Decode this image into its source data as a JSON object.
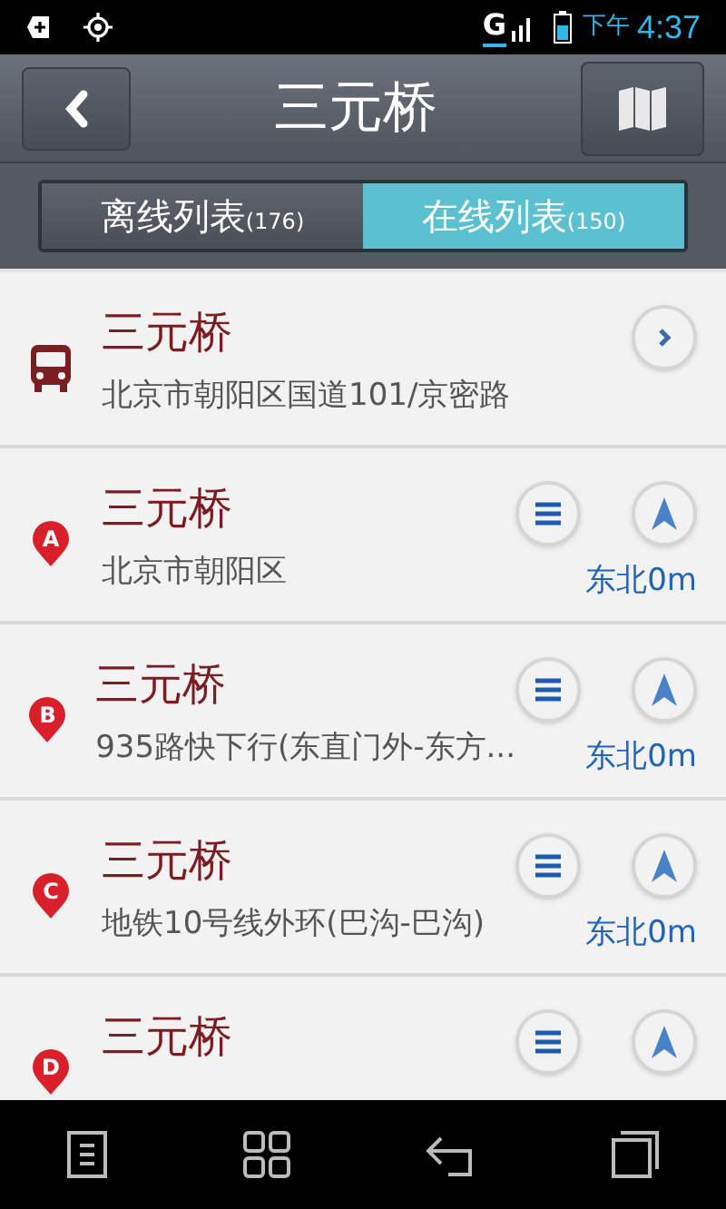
{
  "status_bar": {
    "network": "G",
    "period": "下午",
    "time": "4:37"
  },
  "header": {
    "title": "三元桥"
  },
  "tabs": [
    {
      "label": "离线列表",
      "count": "(176)",
      "selected": false
    },
    {
      "label": "在线列表",
      "count": "(150)",
      "selected": true
    }
  ],
  "results": [
    {
      "kind": "bus",
      "name": "三元桥",
      "address": "北京市朝阳区国道101/京密路"
    },
    {
      "kind": "marker",
      "marker": "A",
      "name": "三元桥",
      "address": "北京市朝阳区",
      "distance": "东北0m"
    },
    {
      "kind": "marker",
      "marker": "B",
      "name": "三元桥",
      "address": "935路快下行(东直门外-东方...",
      "distance": "东北0m"
    },
    {
      "kind": "marker",
      "marker": "C",
      "name": "三元桥",
      "address": "地铁10号线外环(巴沟-巴沟)",
      "distance": "东北0m"
    },
    {
      "kind": "marker",
      "marker": "D",
      "name": "三元桥"
    }
  ]
}
